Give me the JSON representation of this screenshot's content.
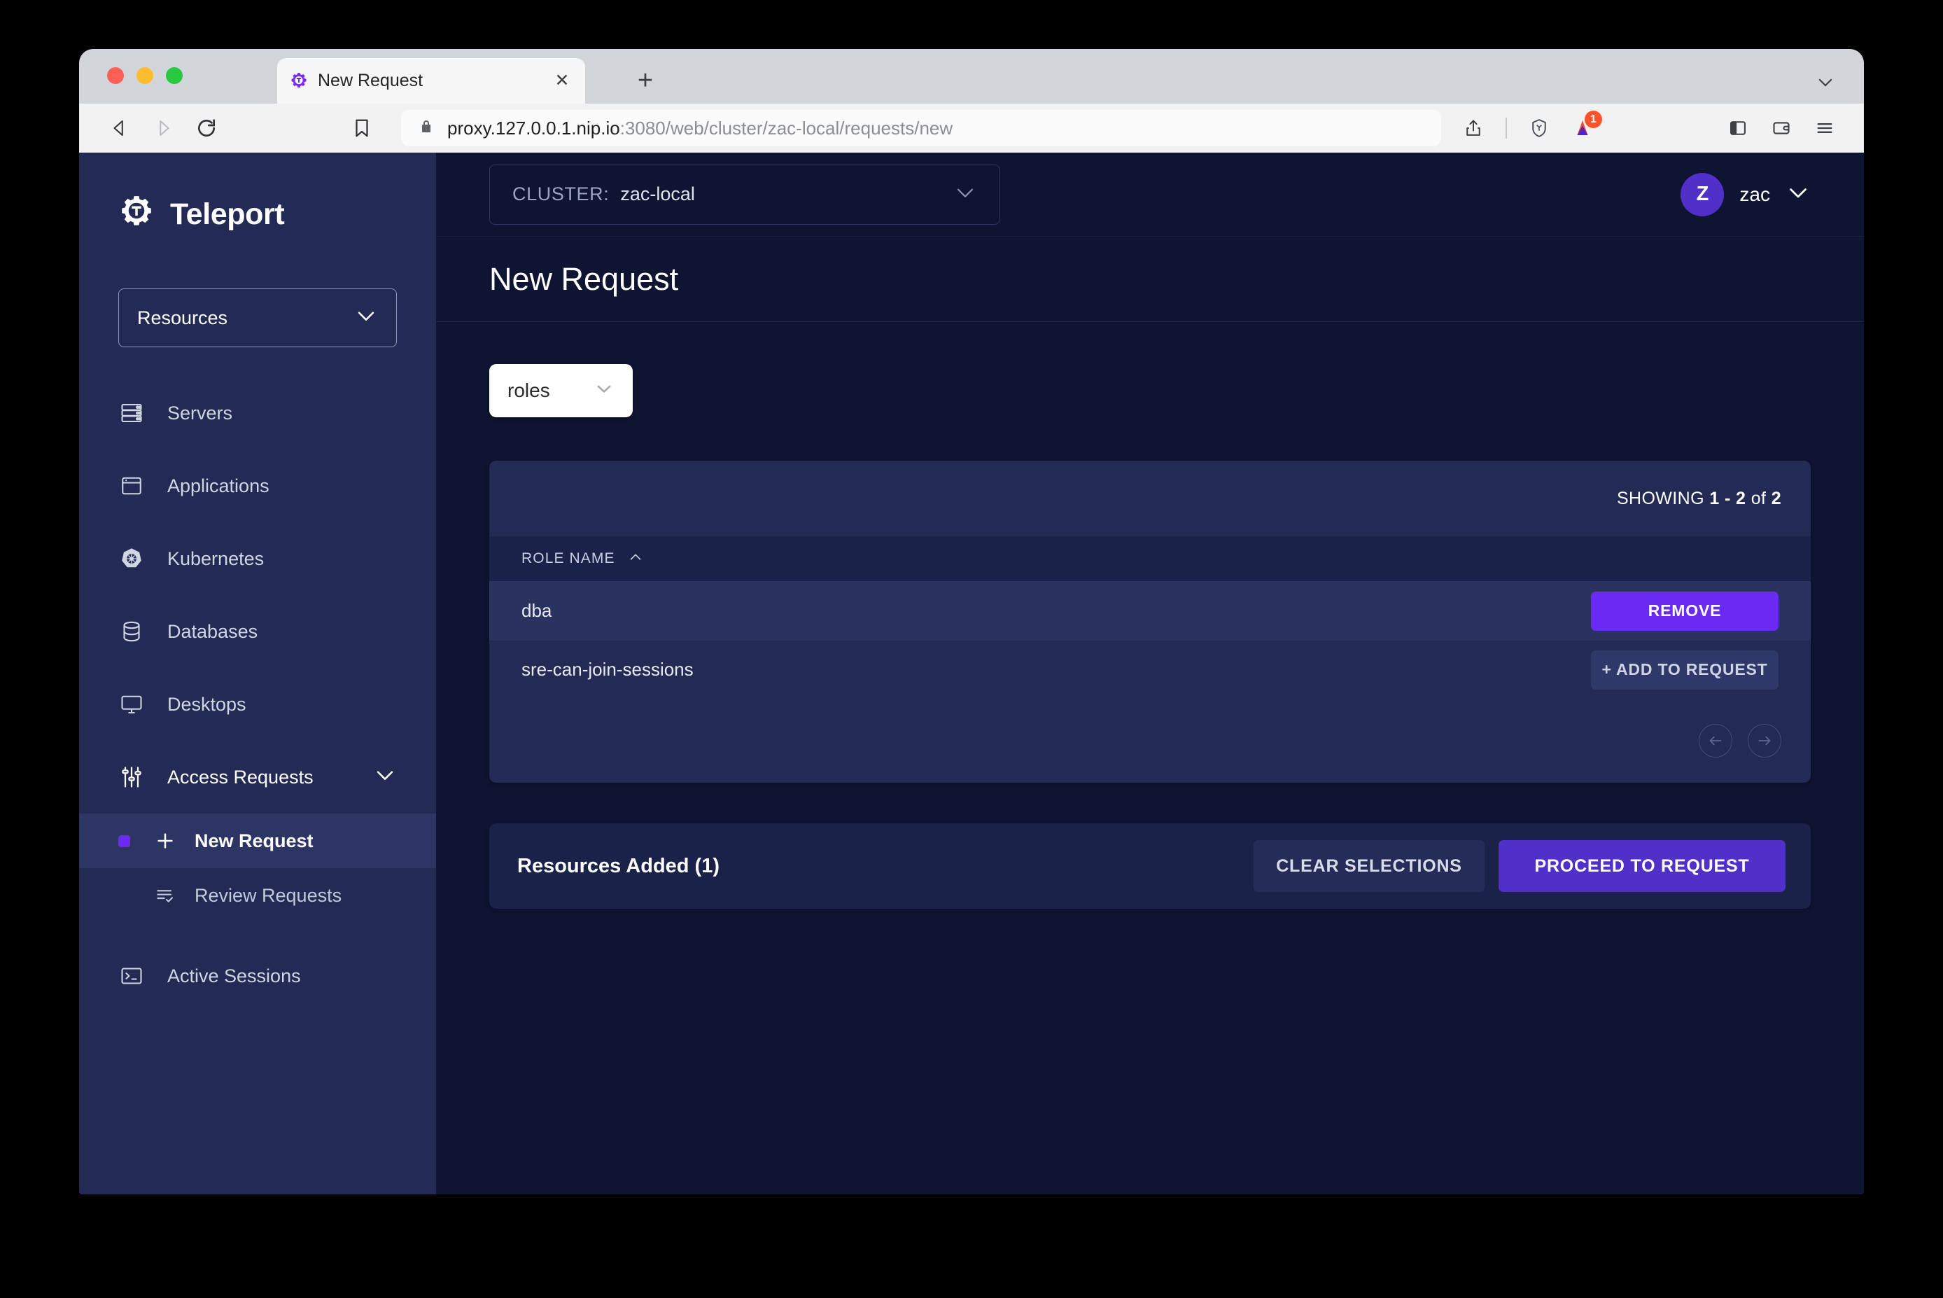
{
  "browser": {
    "tab": {
      "title": "New Request",
      "favicon_icon": "teleport-gear-icon",
      "close_icon": "close-icon"
    },
    "new_tab_icon": "plus-icon",
    "tabstrip_caret_icon": "chevron-down-icon",
    "nav": {
      "back_icon": "back-arrow-icon",
      "forward_icon": "forward-arrow-icon",
      "reload_icon": "reload-icon",
      "bookmark_icon": "bookmark-icon"
    },
    "url": {
      "lock_icon": "lock-icon",
      "host": "proxy.127.0.0.1.nip.io",
      "path": ":3080/web/cluster/zac-local/requests/new"
    },
    "toolbar_right": {
      "share_icon": "share-icon",
      "brave_icon": "brave-lion-icon",
      "rewards_icon": "brave-rewards-triangle-icon",
      "rewards_badge": "1",
      "sidebar_icon": "sidebar-panel-icon",
      "wallet_icon": "wallet-icon",
      "menu_icon": "hamburger-menu-icon"
    }
  },
  "sidebar": {
    "brand": {
      "name": "Teleport",
      "logo_icon": "teleport-gear-icon"
    },
    "resources_select": {
      "label": "Resources",
      "caret_icon": "chevron-down-icon"
    },
    "items": [
      {
        "label": "Servers",
        "icon": "server-icon"
      },
      {
        "label": "Applications",
        "icon": "application-window-icon"
      },
      {
        "label": "Kubernetes",
        "icon": "kubernetes-helm-icon"
      },
      {
        "label": "Databases",
        "icon": "database-icon"
      },
      {
        "label": "Desktops",
        "icon": "desktop-monitor-icon"
      },
      {
        "label": "Access Requests",
        "icon": "sliders-icon",
        "caret_icon": "chevron-down-icon"
      }
    ],
    "sub_items": [
      {
        "label": "New Request",
        "icon": "plus-icon",
        "active": true
      },
      {
        "label": "Review Requests",
        "icon": "list-check-icon",
        "active": false
      }
    ],
    "bottom_items": [
      {
        "label": "Active Sessions",
        "icon": "terminal-icon"
      }
    ]
  },
  "topbar": {
    "cluster_label": "CLUSTER:",
    "cluster_value": "zac-local",
    "cluster_caret_icon": "chevron-down-icon",
    "user": {
      "initial": "Z",
      "name": "zac",
      "caret_icon": "chevron-down-icon"
    }
  },
  "page": {
    "title": "New Request",
    "kind_select": {
      "value": "roles",
      "caret_icon": "chevron-down-icon"
    }
  },
  "table": {
    "showing_prefix": "SHOWING ",
    "showing_range": "1 - 2",
    "showing_middle": " of ",
    "showing_total": "2",
    "columns": [
      {
        "label": "ROLE NAME",
        "sort_icon": "chevron-up-icon"
      }
    ],
    "rows": [
      {
        "name": "dba",
        "action_label": "REMOVE",
        "action_state": "added"
      },
      {
        "name": "sre-can-join-sessions",
        "action_label": "+ ADD TO REQUEST",
        "action_state": "not-added"
      }
    ],
    "pagination": {
      "prev_icon": "arrow-left-circle-icon",
      "next_icon": "arrow-right-circle-icon"
    }
  },
  "footer": {
    "added_label": "Resources Added (1)",
    "clear_label": "CLEAR SELECTIONS",
    "proceed_label": "PROCEED TO REQUEST"
  },
  "colors": {
    "accent_purple": "#6b29f4",
    "button_purple": "#512fc9",
    "sidebar_bg": "#232a53",
    "main_bg": "#0e1431",
    "card_bg": "#232a53",
    "table_head_bg": "#1b2249",
    "badge_orange": "#fb542b"
  }
}
